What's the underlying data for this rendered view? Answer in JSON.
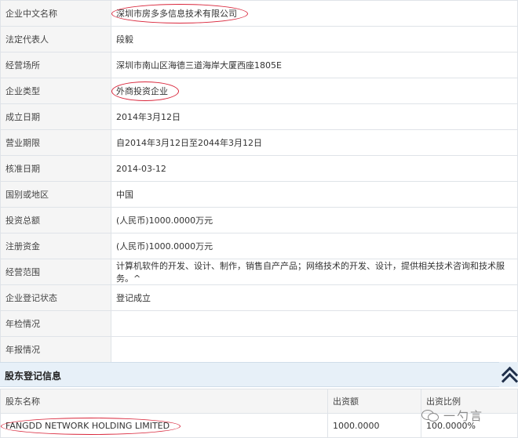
{
  "basic_info": [
    {
      "label": "企业中文名称",
      "value": "深圳市房多多信息技术有限公司"
    },
    {
      "label": "法定代表人",
      "value": "段毅"
    },
    {
      "label": "经营场所",
      "value": "深圳市南山区海德三道海岸大厦西座1805E"
    },
    {
      "label": "企业类型",
      "value": "外商投资企业"
    },
    {
      "label": "成立日期",
      "value": "2014年3月12日"
    },
    {
      "label": "营业期限",
      "value": "自2014年3月12日至2044年3月12日"
    },
    {
      "label": "核准日期",
      "value": "2014-03-12"
    },
    {
      "label": "国别或地区",
      "value": "中国"
    },
    {
      "label": "投资总额",
      "value": "(人民币)1000.0000万元"
    },
    {
      "label": "注册资金",
      "value": "(人民币)1000.0000万元"
    },
    {
      "label": "经营范围",
      "value": "计算机软件的开发、设计、制作，销售自产产品；网络技术的开发、设计，提供相关技术咨询和技术服务。^"
    },
    {
      "label": "企业登记状态",
      "value": "登记成立"
    },
    {
      "label": "年检情况",
      "value": ""
    },
    {
      "label": "年报情况",
      "value": ""
    }
  ],
  "shareholder_section": {
    "title": "股东登记信息",
    "headers": [
      "股东名称",
      "出资额",
      "出资比例"
    ],
    "rows": [
      {
        "name": "FANGDD NETWORK HOLDING LIMITED",
        "amount": "1000.0000",
        "ratio": "100.0000%"
      }
    ]
  },
  "watermark": {
    "text": "一勺言",
    "icon": "wechat-icon"
  },
  "colors": {
    "annotation_circle": "#d9263b",
    "section_bg": "#e7f0f8",
    "label_bg": "#f5f5f5"
  }
}
